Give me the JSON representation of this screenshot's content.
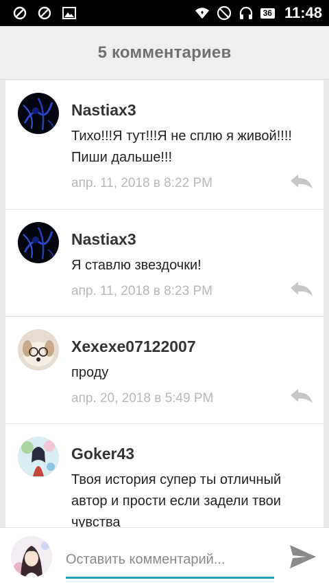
{
  "status_bar": {
    "battery": "36",
    "time": "11:48",
    "icons": [
      "blocked-icon",
      "blocked-icon",
      "image-icon",
      "wifi-icon",
      "do-not-disturb-icon",
      "headset-icon",
      "battery-icon"
    ]
  },
  "header": {
    "title": "5 комментариев"
  },
  "comments": [
    {
      "author": "Nastiax3",
      "text": "Тихо!!!Я тут!!!Я не сплю я живой!!!! Пиши дальше!!!",
      "date": "апр. 11, 2018 в 8:22 PM"
    },
    {
      "author": "Nastiax3",
      "text": "Я ставлю звездочки!",
      "date": "апр. 11, 2018 в 8:23 PM"
    },
    {
      "author": "Xexexe07122007",
      "text": "проду",
      "date": "апр. 20, 2018 в 5:49 PM"
    },
    {
      "author": "Goker43",
      "text": "Твоя история супер ты отличный автор и прости если задели твои чувства",
      "date": ""
    }
  ],
  "input": {
    "placeholder": "Оставить комментарий..."
  },
  "colors": {
    "accent": "#1e9fb3",
    "header_bg": "#efefef",
    "title": "#707070",
    "date": "#b8b8b8"
  }
}
